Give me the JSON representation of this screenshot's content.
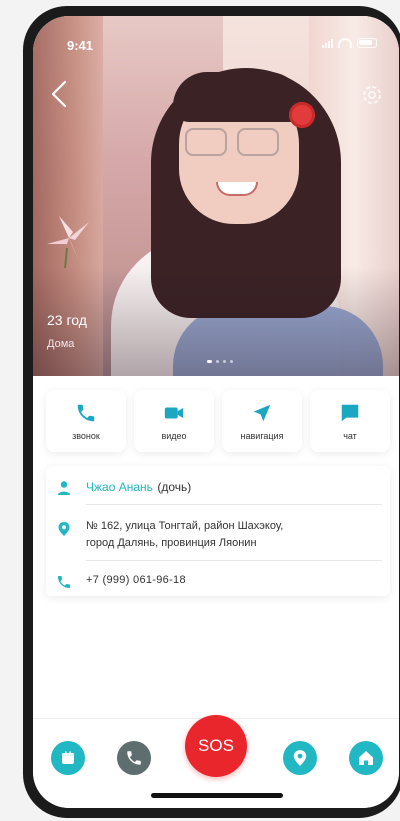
{
  "status": {
    "time": "9:41"
  },
  "header": {
    "back_icon": "chevron-left-icon",
    "settings_icon": "gear-icon"
  },
  "profile": {
    "age": "23 год",
    "location": "Дома"
  },
  "actions": [
    {
      "label": "звонок",
      "icon": "phone-icon"
    },
    {
      "label": "видео",
      "icon": "video-camera-icon"
    },
    {
      "label": "навигация",
      "icon": "navigation-arrow-icon"
    },
    {
      "label": "чат",
      "icon": "chat-bubble-icon"
    }
  ],
  "contact": {
    "name": "Чжао Анань",
    "relation": "(дочь)",
    "address_line1": "№ 162, улица Тонгтай, район Шахэкоу,",
    "address_line2": "город Далянь, провинция Ляонин",
    "phone": "+7 (999) 061-96-18"
  },
  "bottom_nav": {
    "sos_label": "SOS",
    "items": [
      "calendar-icon",
      "phone-icon",
      "location-pin-icon",
      "home-icon"
    ]
  },
  "colors": {
    "accent": "#21b8c4",
    "sos": "#e9262c",
    "grey_button": "#5e6e6e"
  }
}
